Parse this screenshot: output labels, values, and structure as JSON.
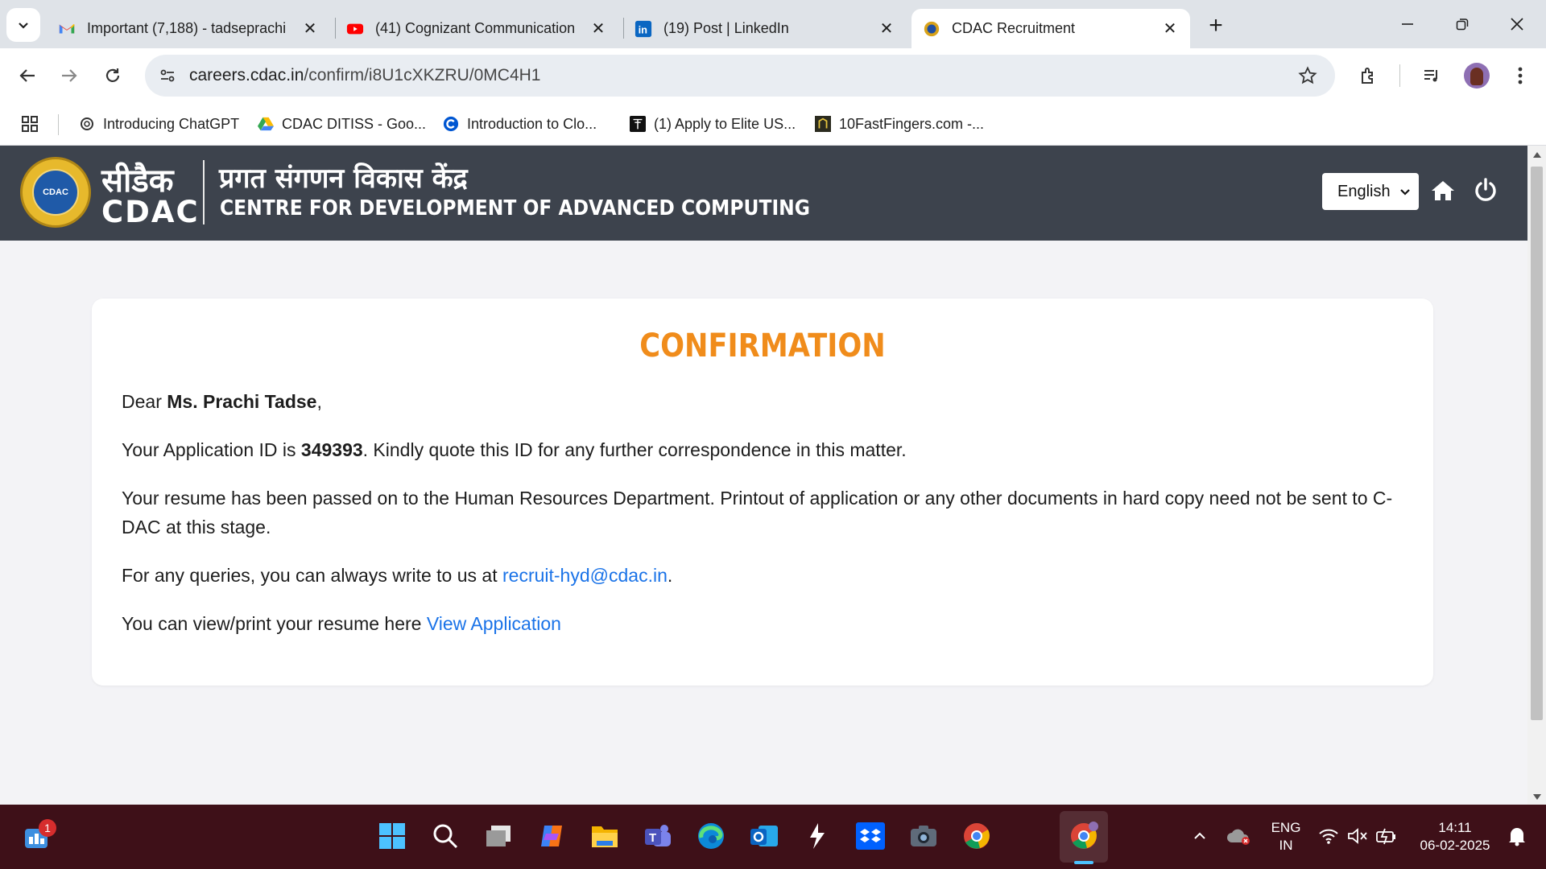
{
  "browser": {
    "tabs": [
      {
        "title": "Important (7,188) - tadseprachi",
        "icon": "gmail-icon"
      },
      {
        "title": "(41) Cognizant Communication",
        "icon": "youtube-icon"
      },
      {
        "title": "(19) Post | LinkedIn",
        "icon": "linkedin-icon"
      },
      {
        "title": "CDAC Recruitment",
        "icon": "cdac-icon"
      }
    ],
    "url_host": "careers.cdac.in",
    "url_path": "/confirm/i8U1cXKZRU/0MC4H1",
    "bookmarks": [
      {
        "label": "Introducing ChatGPT",
        "icon": "openai-icon"
      },
      {
        "label": "CDAC DITISS - Goo...",
        "icon": "google-drive-icon"
      },
      {
        "label": "Introduction to Clo...",
        "icon": "coursera-icon"
      },
      {
        "label": "(1) Apply to Elite US...",
        "icon": "turing-icon"
      },
      {
        "label": "10FastFingers.com -...",
        "icon": "fastfingers-icon"
      }
    ]
  },
  "site": {
    "logo_hindi": "सीडैक",
    "logo_en": "CDAC",
    "title_hindi": "प्रगत संगणन विकास केंद्र",
    "title_en": "CENTRE FOR DEVELOPMENT OF ADVANCED COMPUTING",
    "language": "English",
    "header_color": "#3d434d"
  },
  "confirmation": {
    "heading": "CONFIRMATION",
    "heading_color": "#f08c1b",
    "dear": "Dear",
    "name": "Ms. Prachi Tadse",
    "name_suffix": ",",
    "app_id_prefix": "Your Application ID is",
    "app_id": "349393",
    "app_id_suffix": ". Kindly quote this ID for any further correspondence in this matter.",
    "resume_text": "Your resume has been passed on to the Human Resources Department. Printout of application or any other documents in hard copy need not be sent to C-DAC at this stage.",
    "query_prefix": "For any queries, you can always write to us at",
    "email": "recruit-hyd@cdac.in",
    "query_suffix": ".",
    "view_prefix": "You can view/print your resume here",
    "view_link": "View Application"
  },
  "taskbar": {
    "widget_badge": "1",
    "lang_line1": "ENG",
    "lang_line2": "IN",
    "time": "14:11",
    "date": "06-02-2025"
  }
}
